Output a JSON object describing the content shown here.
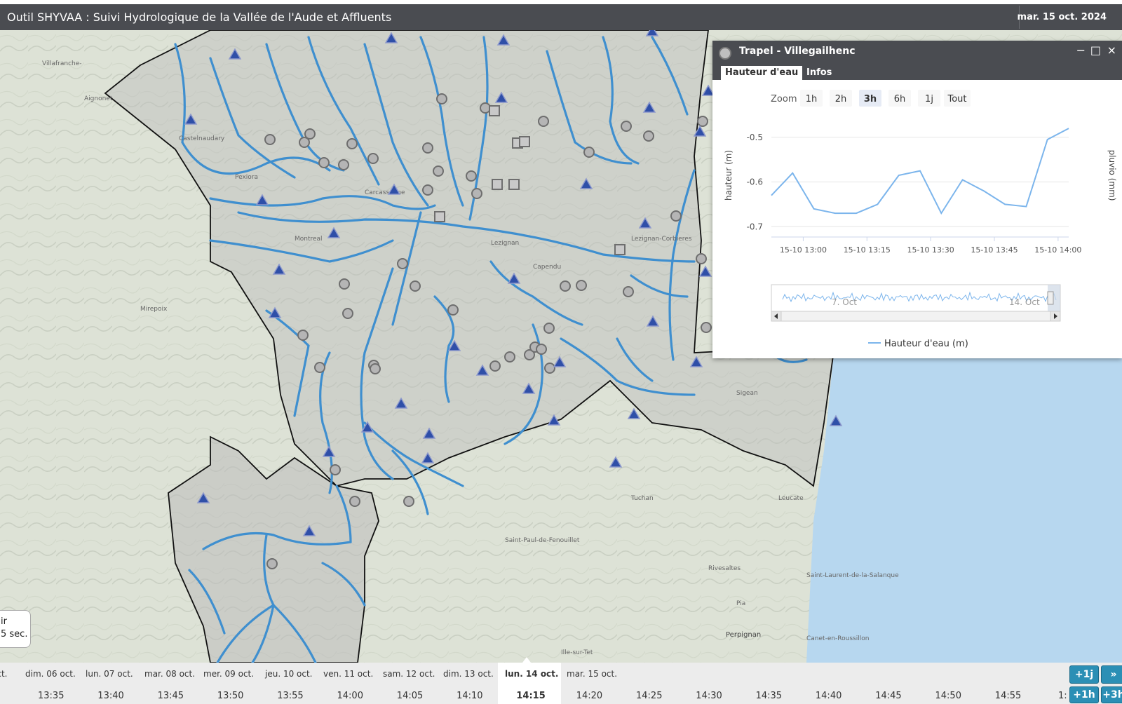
{
  "header": {
    "title": "Outil SHYVAA : Suivi Hydrologique de la Vallée de l'Aude et Affluents",
    "date": "mar. 15 oct. 2024"
  },
  "popup": {
    "title": "Trapel - Villegailhenc",
    "tabs": [
      {
        "label": "Hauteur d'eau",
        "active": true
      },
      {
        "label": "Infos",
        "active": false
      }
    ],
    "window_controls": [
      "−",
      "□",
      "×"
    ],
    "zoom": {
      "label": "Zoom",
      "options": [
        "1h",
        "2h",
        "3h",
        "6h",
        "1j",
        "Tout"
      ],
      "selected": "3h"
    }
  },
  "chart_data": {
    "type": "line",
    "ylabel": "hauteur (m)",
    "ylabel_right": "pluvio (mm)",
    "ylim": [
      -0.72,
      -0.45
    ],
    "yticks": [
      "-0.5",
      "-0.6",
      "-0.7"
    ],
    "xticks": [
      "15-10 13:00",
      "15-10 13:15",
      "15-10 13:30",
      "15-10 13:45",
      "15-10 14:00"
    ],
    "series": [
      {
        "name": "Hauteur d'eau (m)",
        "color": "#7cb5ec",
        "x": [
          0,
          5,
          10,
          15,
          20,
          25,
          30,
          35,
          40,
          45,
          50,
          55,
          60,
          65,
          70
        ],
        "values": [
          -0.63,
          -0.58,
          -0.66,
          -0.67,
          -0.67,
          -0.65,
          -0.585,
          -0.575,
          -0.67,
          -0.595,
          -0.62,
          -0.65,
          -0.655,
          -0.505,
          -0.48
        ]
      }
    ],
    "navigator_labels": [
      "7. Oct",
      "14. Oct"
    ],
    "legend": "bottom-center"
  },
  "timeline": {
    "days": [
      "oct.",
      "dim. 06 oct.",
      "lun. 07 oct.",
      "mar. 08 oct.",
      "mer. 09 oct.",
      "jeu. 10 oct.",
      "ven. 11 oct.",
      "sam. 12 oct.",
      "dim. 13 oct.",
      "lun. 14 oct.",
      "mar. 15 oct."
    ],
    "times": [
      "13:35",
      "13:40",
      "13:45",
      "13:50",
      "13:55",
      "14:00",
      "14:05",
      "14:10",
      "14:15",
      "14:20",
      "14:25",
      "14:30",
      "14:35",
      "14:40",
      "14:45",
      "14:50",
      "14:55",
      "1:"
    ],
    "selected_day": "lun. 14 oct.",
    "selected_time": "14:15",
    "buttons": {
      "plus1j": "+1j",
      "forward": "»",
      "plus1h": "+1h",
      "plus3h": "+3h"
    }
  },
  "refresh": {
    "line1": "ir",
    "line2": "5 sec."
  },
  "map_labels": {
    "perpignan": "Perpignan"
  },
  "colors": {
    "header": "#4a4c51",
    "river": "#3f8fcf",
    "sea": "#b7d7ef",
    "station_circle": "#b5b5b5",
    "station_triangle": "#2f4fa8",
    "timeline_button": "#2b8fb5"
  }
}
